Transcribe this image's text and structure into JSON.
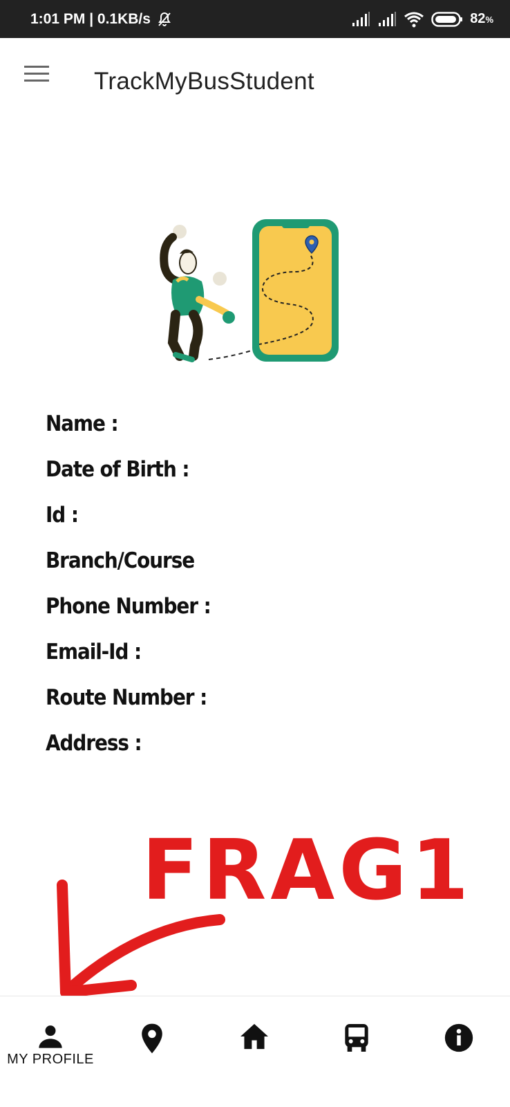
{
  "status_bar": {
    "time_speed": "1:01 PM | 0.1KB/s",
    "battery_percent": "82",
    "battery_unit": "%",
    "icons": [
      "mute-bell-icon",
      "signal-icon",
      "signal-icon",
      "wifi-icon",
      "battery-icon"
    ]
  },
  "app_bar": {
    "title": "TrackMyBusStudent",
    "menu_icon": "hamburger-menu-icon"
  },
  "profile": {
    "fields": [
      "Name :",
      "Date of Birth :",
      "Id :",
      "Branch/Course",
      "Phone Number :",
      "Email-Id :",
      "Route Number :",
      "Address :"
    ]
  },
  "annotation": {
    "text": "FRAG1",
    "color": "#e21d1d"
  },
  "bottom_nav": {
    "items": [
      {
        "icon": "person-icon",
        "label": "MY PROFILE"
      },
      {
        "icon": "location-pin-icon",
        "label": ""
      },
      {
        "icon": "home-icon",
        "label": ""
      },
      {
        "icon": "bus-icon",
        "label": ""
      },
      {
        "icon": "info-icon",
        "label": ""
      }
    ]
  },
  "colors": {
    "status_bar_bg": "#222222",
    "accent_green": "#1f9a73",
    "accent_yellow": "#f8c94f",
    "annotation_red": "#e21d1d"
  }
}
